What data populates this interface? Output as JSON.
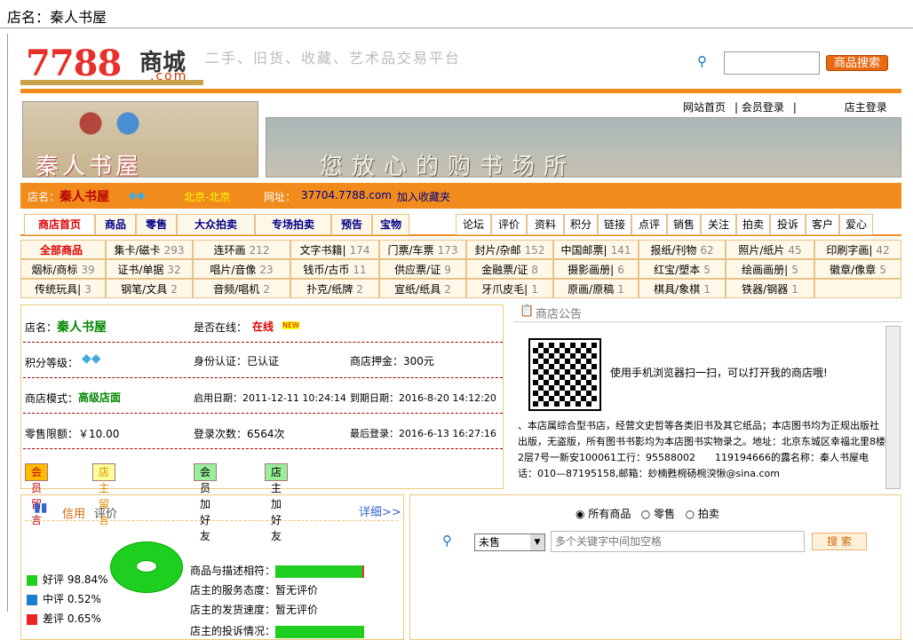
{
  "shop_label": "店名：秦人书屋",
  "header": {
    "logo_num": "7788",
    "logo_mall": "商城",
    "logo_com": ".com",
    "slogan": "二手、旧货、收藏、艺术品交易平台",
    "search_button": "商品搜索",
    "search_icon": "search-icon"
  },
  "toplinks": [
    "网站首页",
    "会员登录",
    "店主登录"
  ],
  "banner": {
    "shop_name_art": "秦人书屋",
    "slogan_art": "您放心的购书场所"
  },
  "infobar": {
    "label": "店名：",
    "name": "秦人书屋",
    "location": "北京-北京",
    "url_label": "网址：",
    "url": "37704.7788.com",
    "favorite": "加入收藏夹"
  },
  "nav": [
    "商店首页",
    "商品",
    "零售",
    "大众拍卖",
    "专场拍卖",
    "预告",
    "宝物"
  ],
  "nav_right": [
    "论坛",
    "评价",
    "资料",
    "积分",
    "链接",
    "点评",
    "销售",
    "关注",
    "拍卖",
    "投诉",
    "客户",
    "爱心"
  ],
  "categories": [
    [
      {
        "n": "全部商品",
        "c": ""
      },
      {
        "n": "集卡/磁卡",
        "c": "293"
      },
      {
        "n": "连环画",
        "c": "212"
      },
      {
        "n": "文字书籍|",
        "c": "174"
      },
      {
        "n": "门票/车票",
        "c": "173"
      },
      {
        "n": "封片/杂邮",
        "c": "152"
      },
      {
        "n": "中国邮票|",
        "c": "141"
      },
      {
        "n": "报纸/刊物",
        "c": "62"
      },
      {
        "n": "照片/纸片",
        "c": "45"
      },
      {
        "n": "印刷字画|",
        "c": "42"
      }
    ],
    [
      {
        "n": "烟标/商标",
        "c": "39"
      },
      {
        "n": "证书/单据",
        "c": "32"
      },
      {
        "n": "唱片/音像",
        "c": "23"
      },
      {
        "n": "钱币/古币",
        "c": "11"
      },
      {
        "n": "供应票/证",
        "c": "9"
      },
      {
        "n": "金融票/证",
        "c": "8"
      },
      {
        "n": "摄影画册|",
        "c": "6"
      },
      {
        "n": "红宝/塑本",
        "c": "5"
      },
      {
        "n": "绘画画册|",
        "c": "5"
      },
      {
        "n": "徽章/像章",
        "c": "5"
      }
    ],
    [
      {
        "n": "传统玩具|",
        "c": "3"
      },
      {
        "n": "钢笔/文具",
        "c": "2"
      },
      {
        "n": "音频/唱机",
        "c": "2"
      },
      {
        "n": "扑克/纸牌",
        "c": "2"
      },
      {
        "n": "宣纸/纸具",
        "c": "2"
      },
      {
        "n": "牙爪皮毛|",
        "c": "1"
      },
      {
        "n": "原画/原稿",
        "c": "1"
      },
      {
        "n": "棋具/象棋",
        "c": "1"
      },
      {
        "n": "铁器/钢器",
        "c": "1"
      },
      {
        "n": "",
        "c": ""
      }
    ]
  ],
  "info": {
    "name_label": "店名：",
    "name": "秦人书屋",
    "online_label": "是否在线：",
    "online": "在线",
    "new_badge": "NEW",
    "points_label": "积分等级：",
    "id_label": "身份认证：已认证",
    "deposit": "商店押金：300元",
    "mode_label": "商店模式：",
    "mode": "高级店面",
    "start": "启用日期：2011-12-11 10:24:14",
    "end": "到期日期：2016-8-20 14:12:20",
    "limit": "零售限额：￥10.00",
    "logins": "登录次数：6564次",
    "last": "最后登录：2016-6-13 16:27:16",
    "btn1": "会员留言",
    "btn2": "店主留言",
    "btn3": "会员加好友",
    "btn4": "店主加好友"
  },
  "notice": {
    "title": "商店公告",
    "qr_text": "使用手机浏览器扫一扫，可以打开我的商店哦!",
    "body": "、本店属综合型书店，经营文史哲等各类旧书及其它纸品；本店图书均为正规出版社出版，无盗版，所有图书书影均为本店图书实物录之。地址：北京东城区幸福北里8楼2层7号一新安100061工行：95588002　　119194666的露名称：秦人书屋电话：010—87195158,邮箱：玅楠甦椀砀椀湥愀@sina.com"
  },
  "credit": {
    "title": "信用",
    "sub": "评价",
    "detail": "详细>>",
    "good": "好评 98.84%",
    "mid": "中评 0.52%",
    "bad": "差评 0.65%",
    "r1": "商品与描述相符：",
    "r2": "店主的服务态度：暂无评价",
    "r3": "店主的发货速度：暂无评价",
    "r4": "店主的投诉情况："
  },
  "search2": {
    "opt1": "所有商品",
    "opt2": "零售",
    "opt3": "拍卖",
    "select": "未售",
    "placeholder": "多个关键字中间加空格",
    "button": "搜 索"
  }
}
